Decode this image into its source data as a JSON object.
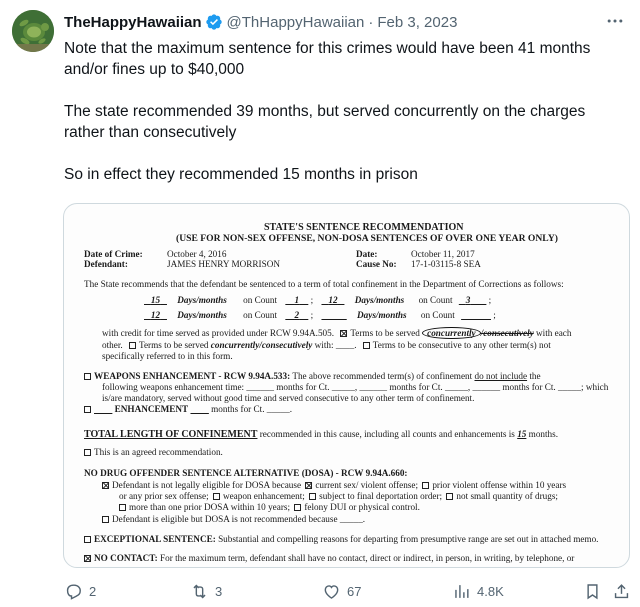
{
  "tweet": {
    "display_name": "TheHappyHawaiian",
    "handle": "@ThHappyHawaiian",
    "separator": "·",
    "date": "Feb 3, 2023",
    "paragraphs": [
      "Note that the maximum sentence for this crimes would have been 41 months and/or fines up to $40,000",
      "The state recommended 39 months, but served concurrently on the charges rather than consecutively",
      "So in effect they recommended 15 months in prison"
    ]
  },
  "document": {
    "title": "STATE'S SENTENCE RECOMMENDATION",
    "subtitle": "(USE FOR NON-SEX OFFENSE, NON-DOSA SENTENCES OF OVER ONE YEAR ONLY)",
    "date_of_crime_label": "Date of Crime:",
    "date_of_crime": "October 4, 2016",
    "defendant_label": "Defendant:",
    "defendant": "JAMES HENRY MORRISON",
    "date_label": "Date:",
    "date": "October 11, 2017",
    "cause_label": "Cause No:",
    "cause_no": "17-1-03115-8 SEA",
    "intro": "The State recommends that the defendant be sentenced to a term of total confinement in the Department of Corrections as follows:",
    "row1": {
      "a": "15",
      "unit": "Days/months",
      "on_count": "on Count",
      "c1": "1",
      "b": "12",
      "c2": "3"
    },
    "row2": {
      "a": "12",
      "unit": "Days/months",
      "on_count": "on Count",
      "c1": "2",
      "c2": "",
      "sep": ";"
    },
    "credit_line_a": "with credit for time served as provided under RCW 9.94A.505.",
    "credit_line_b": "Terms to be served",
    "concurrently": "concurrently",
    "consecutively": "/consecutively",
    "credit_line_c": "with each",
    "other_line_a": "other.",
    "other_line_b": "Terms to be served",
    "other_line_hw": "concurrently/consecutively",
    "other_line_c": "with:",
    "other_line_d": "Terms to be consecutive to any other term(s) not",
    "other_line_e": "specifically referred to in this form.",
    "weapons_head": "WEAPONS ENHANCEMENT - RCW 9.94A.533:",
    "weapons_a": "The above recommended term(s) of confinement",
    "weapons_not": "do not include",
    "weapons_b": "the",
    "weapons_line2": "following weapons enhancement time: ______ months for Ct. _____, ______ months for Ct. _____, ______ months for Ct. _____; which",
    "weapons_line3": "is/are mandatory, served without good time and served consecutive to any other term of confinement.",
    "enh_label": "ENHANCEMENT",
    "enh_rest": "months for Ct. _____.",
    "total_label": "TOTAL LENGTH OF CONFINEMENT",
    "total_rest": "recommended in this cause, including all counts and enhancements is",
    "total_value": "15",
    "total_unit": "months.",
    "agreed": "This is an agreed recommendation.",
    "dosa_head": "NO DRUG OFFENDER SENTENCE ALTERNATIVE (DOSA) - RCW 9.94A.660:",
    "dosa_1a": "Defendant is not legally eligible for DOSA because",
    "dosa_1b": "current sex/ violent offense;",
    "dosa_1c": "prior violent offense within 10 years",
    "dosa_2a": "or any prior sex offense;",
    "dosa_2b": "weapon enhancement;",
    "dosa_2c": "subject to final deportation order;",
    "dosa_2d": "not small quantity of drugs;",
    "dosa_3a": "more than one prior DOSA within 10 years;",
    "dosa_3b": "felony DUI or physical control.",
    "dosa_4": "Defendant is eligible but DOSA is not recommended because _____.",
    "exc_head": "EXCEPTIONAL SENTENCE:",
    "exc_rest": "Substantial and compelling reasons for departing from presumptive range are set out in attached memo.",
    "nc_head": "NO CONTACT:",
    "nc_rest": "For the maximum term, defendant shall have no contact, direct or indirect, in person, in writing, by telephone, or"
  },
  "actions": {
    "replies": "2",
    "retweets": "3",
    "likes": "67",
    "views": "4.8K"
  },
  "colors": {
    "verified": "#1d9bf0",
    "muted": "#536471",
    "text": "#0f1419",
    "border": "#cfd9de"
  },
  "icons": [
    "more-icon",
    "verified-badge-icon",
    "reply-icon",
    "retweet-icon",
    "like-icon",
    "views-icon",
    "bookmark-icon",
    "share-icon"
  ]
}
